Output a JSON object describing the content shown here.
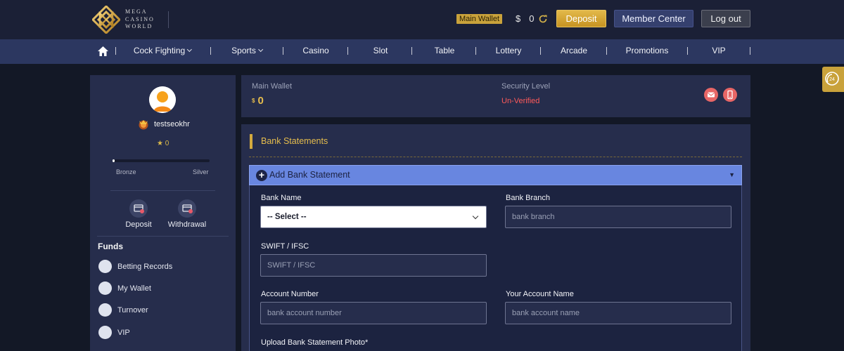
{
  "brand": {
    "logo_text": [
      "MEGA",
      "CASINO",
      "WORLD"
    ],
    "accent": "#c9a23b"
  },
  "header": {
    "wallet_chip": "Main Wallet",
    "currency": "$",
    "balance": "0",
    "deposit_label": "Deposit",
    "member_center_label": "Member Center",
    "logout_label": "Log out"
  },
  "nav": {
    "items": [
      {
        "label": "Cock Fighting",
        "dropdown": true
      },
      {
        "label": "Sports",
        "dropdown": true
      },
      {
        "label": "Casino"
      },
      {
        "label": "Slot"
      },
      {
        "label": "Table"
      },
      {
        "label": "Lottery"
      },
      {
        "label": "Arcade"
      },
      {
        "label": "Promotions"
      },
      {
        "label": "VIP"
      }
    ]
  },
  "sidebar": {
    "username": "testseokhr",
    "stars": "★ 0",
    "progress_fraction": 0.01,
    "tier_from": "Bronze",
    "tier_to": "Silver",
    "quick": {
      "deposit": "Deposit",
      "withdrawal": "Withdrawal"
    },
    "funds_title": "Funds",
    "menu": [
      {
        "label": "Betting Records",
        "icon": "betting-records-icon"
      },
      {
        "label": "My Wallet",
        "icon": "wallet-icon"
      },
      {
        "label": "Turnover",
        "icon": "turnover-icon"
      },
      {
        "label": "VIP",
        "icon": "vip-icon"
      }
    ]
  },
  "summary": {
    "main_wallet_label": "Main Wallet",
    "main_wallet_currency": "$",
    "main_wallet_value": "0",
    "security_label": "Security Level",
    "security_value": "Un-Verified",
    "security_color": "#ff5a5a"
  },
  "panel": {
    "title": "Bank Statements",
    "accordion_title": "Add Bank Statement",
    "accordion_caret": "▼",
    "form": {
      "bank_name_label": "Bank Name",
      "bank_name_value": "-- Select --",
      "bank_branch_label": "Bank Branch",
      "bank_branch_placeholder": "bank branch",
      "swift_label": "SWIFT / IFSC",
      "swift_placeholder": "SWIFT / IFSC",
      "account_number_label": "Account Number",
      "account_number_placeholder": "bank account number",
      "account_name_label": "Your Account Name",
      "account_name_placeholder": "bank account name",
      "upload_label": "Upload Bank Statement Photo*"
    }
  },
  "support": {
    "badge": "24"
  }
}
